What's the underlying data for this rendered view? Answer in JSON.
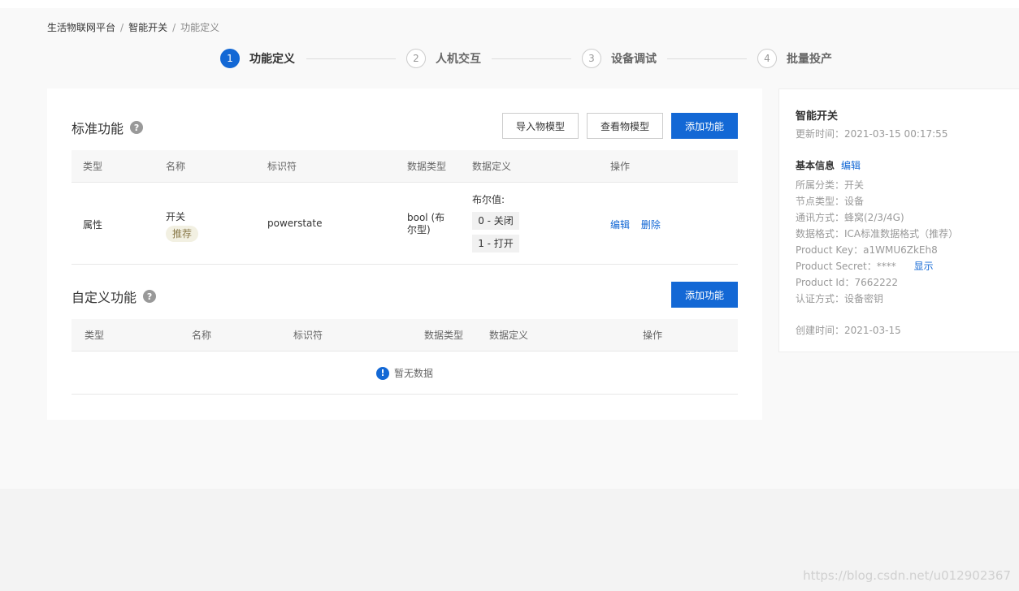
{
  "breadcrumb": [
    "生活物联网平台",
    "智能开关",
    "功能定义"
  ],
  "breadcrumb_sep": "/",
  "steps": [
    {
      "num": "1",
      "label": "功能定义",
      "active": true
    },
    {
      "num": "2",
      "label": "人机交互",
      "active": false
    },
    {
      "num": "3",
      "label": "设备调试",
      "active": false
    },
    {
      "num": "4",
      "label": "批量投产",
      "active": false
    }
  ],
  "standard": {
    "title": "标准功能",
    "help": "?",
    "buttons": {
      "import": "导入物模型",
      "view": "查看物模型",
      "add": "添加功能"
    },
    "columns": [
      "类型",
      "名称",
      "标识符",
      "数据类型",
      "数据定义",
      "操作"
    ],
    "row": {
      "type": "属性",
      "name": "开关",
      "tag": "推荐",
      "identifier": "powerstate",
      "datatype_line1": "bool (布",
      "datatype_line2": "尔型)",
      "def_title": "布尔值:",
      "def_values": [
        "0 - 关闭",
        "1 - 打开"
      ],
      "actions": {
        "edit": "编辑",
        "delete": "删除"
      }
    }
  },
  "custom": {
    "title": "自定义功能",
    "help": "?",
    "buttons": {
      "add": "添加功能"
    },
    "columns": [
      "类型",
      "名称",
      "标识符",
      "数据类型",
      "数据定义",
      "操作"
    ],
    "empty_icon": "!",
    "empty_text": "暂无数据"
  },
  "side": {
    "title": "智能开关",
    "updated": "更新时间：2021-03-15 00:17:55",
    "basic_title": "基本信息",
    "basic_edit": "编辑",
    "category": "所属分类：开关",
    "node_type": "节点类型：设备",
    "comm": "通讯方式：蜂窝(2/3/4G)",
    "data_format": "数据格式：ICA标准数据格式（推荐）",
    "product_key": "Product Key：a1WMU6ZkEh8",
    "product_secret": "Product Secret：****",
    "show": "显示",
    "product_id": "Product Id：7662222",
    "auth": "认证方式：设备密钥",
    "created": "创建时间：2021-03-15"
  },
  "watermark": "https://blog.csdn.net/u012902367",
  "colors": {
    "primary": "#1368d5",
    "tag_bg": "#f2f0e2",
    "tag_text": "#8a7a4a"
  },
  "icons": {
    "help": "question-circle-icon",
    "empty": "info-circle-icon"
  }
}
